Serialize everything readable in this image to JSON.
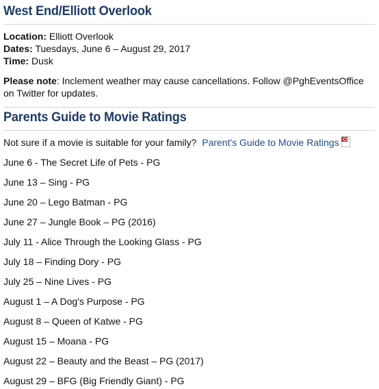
{
  "section1": {
    "title": "West End/Elliott Overlook",
    "location_label": "Location:",
    "location_value": " Elliott Overlook",
    "dates_label": "Dates:",
    "dates_value": " Tuesdays, June 6 – August 29, 2017",
    "time_label": "Time:",
    "time_value": " Dusk",
    "note_label": "Please note",
    "note_text": ":  Inclement weather may cause cancellations.  Follow @PghEventsOffice on Twitter for updates."
  },
  "section2": {
    "title": "Parents Guide to Movie Ratings",
    "intro_text": "Not sure if a movie is suitable for your family?",
    "guide_link": "Parent's Guide to Movie Ratings",
    "guide_icon": "pdf-icon"
  },
  "movies": [
    "June 6 - The Secret Life of Pets - PG",
    "June 13 – Sing - PG",
    "June 20 – Lego Batman - PG",
    "June 27 – Jungle Book – PG (2016)",
    "July 11 - Alice Through the Looking Glass - PG",
    "July 18 – Finding Dory - PG",
    "July 25 – Nine Lives - PG",
    "August 1 – A Dog's Purpose - PG",
    "August 8 – Queen of Katwe - PG",
    "August 15 – Moana - PG",
    "August 22 – Beauty and the Beast – PG (2017)",
    "August 29 – BFG (Big Friendly Giant) - PG"
  ],
  "colors": {
    "heading": "#1f3b66",
    "link": "#1f4b8e",
    "rule": "#d6d6d6"
  }
}
